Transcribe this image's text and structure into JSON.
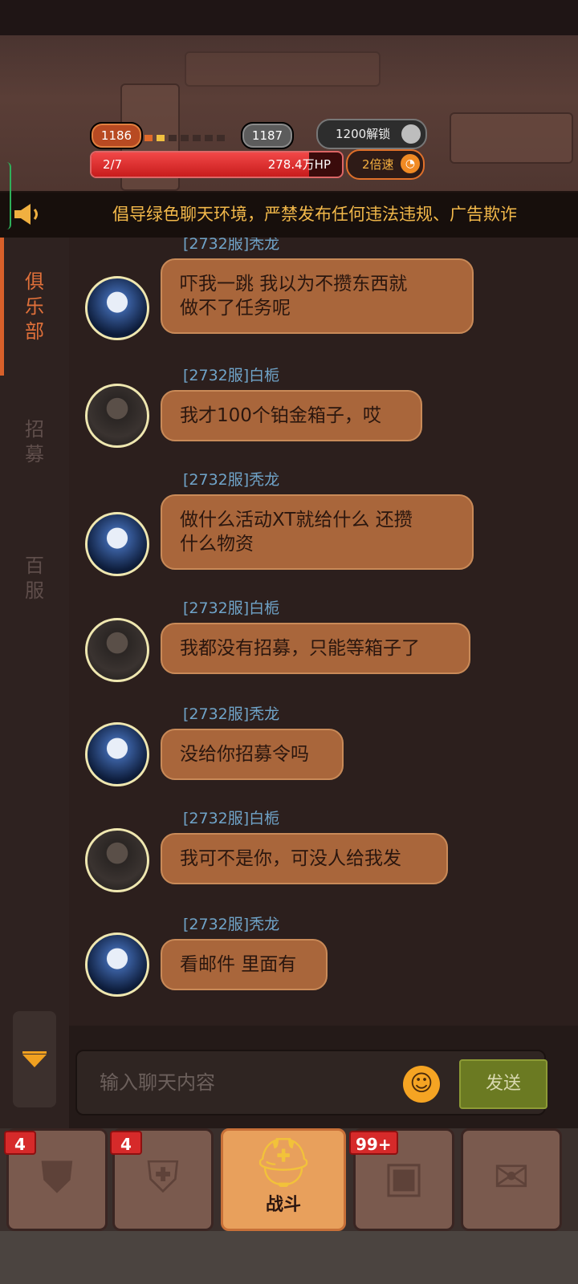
{
  "hud": {
    "level_current": "1186",
    "level_next": "1187",
    "unlock_label": "1200解锁",
    "wave": "2/7",
    "hp": "278.4万HP",
    "hp_fill_fraction": 0.87,
    "speed_label": "2倍速"
  },
  "notice": {
    "text": "倡导绿色聊天环境，严禁发布任何违法违规、广告欺诈"
  },
  "tabs": [
    {
      "label": "俱乐部"
    },
    {
      "label": "招募"
    },
    {
      "label": "百服"
    }
  ],
  "messages": [
    {
      "name": "[2732服]秃龙",
      "text": "吓我一跳 我以为不攒东西就\n做不了任务呢",
      "avatar": "wolf-moon-avatar"
    },
    {
      "name": "[2732服]白栀",
      "text": "我才100个铂金箱子，哎",
      "avatar": "young-man-avatar"
    },
    {
      "name": "[2732服]秃龙",
      "text": "做什么活动XT就给什么 还攒\n什么物资",
      "avatar": "wolf-moon-avatar"
    },
    {
      "name": "[2732服]白栀",
      "text": "我都没有招募，只能等箱子了",
      "avatar": "young-man-avatar"
    },
    {
      "name": "[2732服]秃龙",
      "text": "没给你招募令吗",
      "avatar": "wolf-moon-avatar"
    },
    {
      "name": "[2732服]白栀",
      "text": "我可不是你，可没人给我发",
      "avatar": "young-man-avatar"
    },
    {
      "name": "[2732服]秃龙",
      "text": "看邮件 里面有",
      "avatar": "wolf-moon-avatar"
    }
  ],
  "input": {
    "placeholder": "输入聊天内容",
    "send_label": "发送"
  },
  "bottom_nav": [
    {
      "badge": "4",
      "label": "",
      "icon": "armor-icon"
    },
    {
      "badge": "4",
      "label": "",
      "icon": "chest-armor-icon"
    },
    {
      "badge": "",
      "label": "战斗",
      "icon": "battle-helmet-icon"
    },
    {
      "badge": "99+",
      "label": "",
      "icon": "treasure-chest-icon"
    },
    {
      "badge": "",
      "label": "",
      "icon": "scroll-map-icon"
    }
  ]
}
